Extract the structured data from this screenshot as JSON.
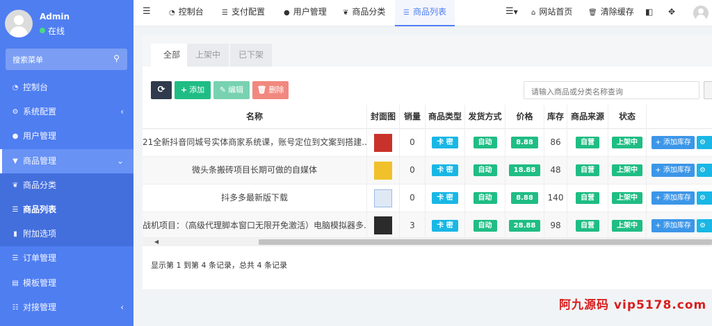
{
  "sidebar": {
    "user": {
      "name": "Admin",
      "status": "在线"
    },
    "search_label": "搜索菜单",
    "items": [
      {
        "label": "控制台",
        "icon": "dashboard-icon"
      },
      {
        "label": "系统配置",
        "icon": "gear-icon",
        "arrow": "‹"
      },
      {
        "label": "用户管理",
        "icon": "user-icon"
      },
      {
        "label": "商品管理",
        "icon": "cart-icon",
        "arrow": "⌄"
      },
      {
        "label": "商品分类",
        "icon": "leaf-icon"
      },
      {
        "label": "商品列表",
        "icon": "list-icon"
      },
      {
        "label": "附加选项",
        "icon": "bookmark-icon"
      },
      {
        "label": "订单管理",
        "icon": "list-icon"
      },
      {
        "label": "模板管理",
        "icon": "template-icon"
      },
      {
        "label": "对接管理",
        "icon": "sliders-icon",
        "arrow": "‹"
      }
    ]
  },
  "topbar": {
    "tabs": [
      {
        "label": "控制台",
        "icon": "dashboard-icon"
      },
      {
        "label": "支付配置",
        "icon": "list-icon"
      },
      {
        "label": "用户管理",
        "icon": "user-icon"
      },
      {
        "label": "商品分类",
        "icon": "leaf-icon"
      },
      {
        "label": "商品列表",
        "icon": "list-icon"
      }
    ],
    "home_link": "网站首页",
    "clear_cache": "清除缓存"
  },
  "panel": {
    "tabs": [
      "全部",
      "上架中",
      "已下架"
    ],
    "buttons": {
      "refresh": "⟳",
      "add": "添加",
      "edit": "编辑",
      "delete": "删除"
    },
    "search_placeholder": "请输入商品或分类名称查询",
    "columns": [
      "名称",
      "封面图",
      "销量",
      "商品类型",
      "发货方式",
      "价格",
      "库存",
      "商品来源",
      "状态"
    ],
    "rows": [
      {
        "name": "21全新抖音同城号实体商家系统课，账号定位到文案到搭建...",
        "sales": "0",
        "type": "卡 密",
        "delivery": "自动",
        "price": "8.88",
        "stock": "86",
        "source": "自营",
        "status": "上架中",
        "action": "添加库存"
      },
      {
        "name": "微头条搬砖项目长期可做的自媒体",
        "sales": "0",
        "type": "卡 密",
        "delivery": "自动",
        "price": "18.88",
        "stock": "48",
        "source": "自营",
        "status": "上架中",
        "action": "添加库存"
      },
      {
        "name": "抖多多最新版下载",
        "sales": "0",
        "type": "卡 密",
        "delivery": "自动",
        "price": "8.88",
        "stock": "140",
        "source": "自营",
        "status": "上架中",
        "action": "添加库存"
      },
      {
        "name": "战机项目：（高级代理脚本窗口无限开免激活）电脑模拟器多...",
        "sales": "3",
        "type": "卡 密",
        "delivery": "自动",
        "price": "28.88",
        "stock": "98",
        "source": "自营",
        "status": "上架中",
        "action": "添加库存"
      }
    ],
    "pager": "显示第 1 到第 4 条记录，总共 4 条记录"
  },
  "watermark": "阿九源码  vip5178.com",
  "colors": {
    "accent": "#4f7ef1",
    "cyan": "#19b7e5",
    "green": "#1fbd84",
    "dark": "#2f3b4c",
    "danger": "#f1887f",
    "watermark": "#d81e1e"
  }
}
